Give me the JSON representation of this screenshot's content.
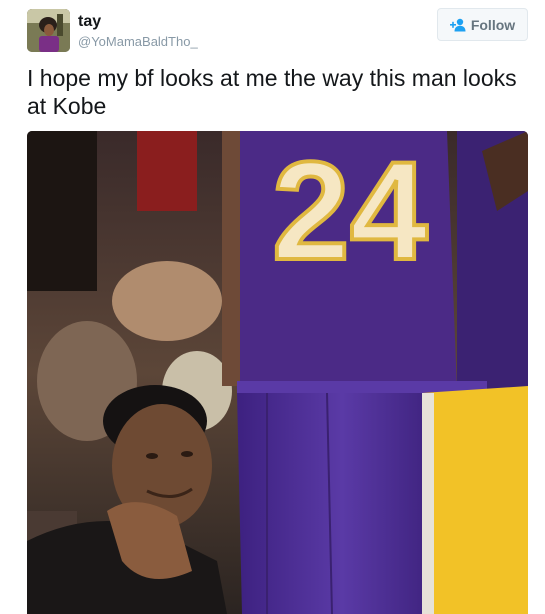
{
  "user": {
    "display_name": "tay",
    "handle": "@YoMamaBaldTho_",
    "avatar_icon": "avatar-photo"
  },
  "follow_button": {
    "label": "Follow",
    "icon": "add-person-icon"
  },
  "tweet": {
    "text": "I hope my bf looks at me the way this man looks at Kobe"
  },
  "media": {
    "jersey_number": "24",
    "description_icon": "photo"
  },
  "colors": {
    "text": "#14171a",
    "secondary_text": "#8899a6",
    "accent": "#1da1f2",
    "button_bg": "#f5f8fa",
    "button_border": "#e1e8ed",
    "jersey_purple": "#4b2a86",
    "jersey_gold": "#f2c227"
  }
}
